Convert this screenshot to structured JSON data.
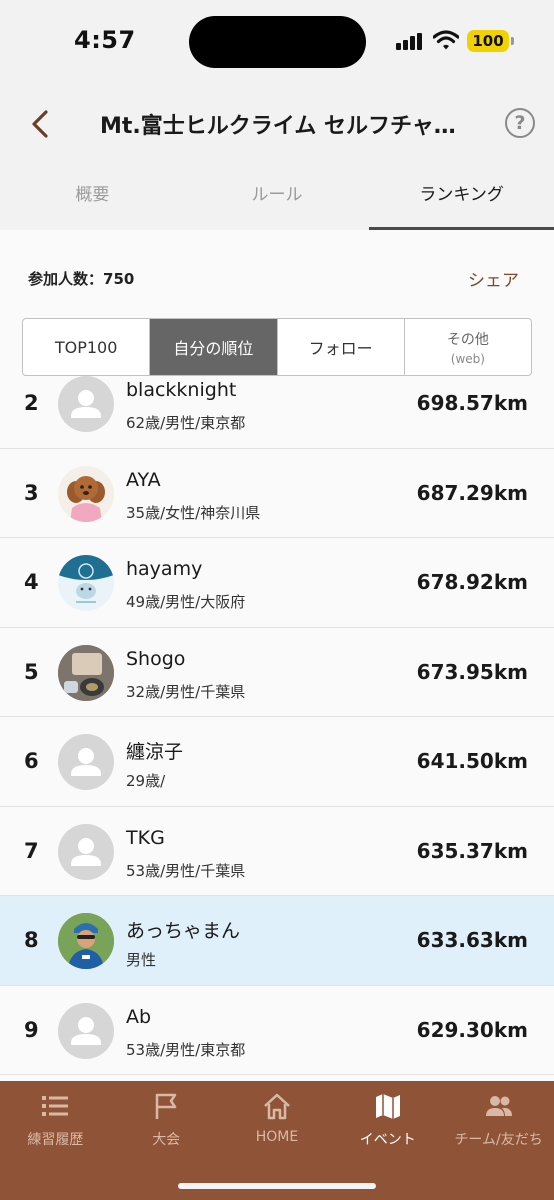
{
  "status": {
    "time": "4:57",
    "battery": "100"
  },
  "header": {
    "title": "Mt.富士ヒルクライム セルフチャ…",
    "help": "?"
  },
  "tabs": [
    {
      "label": "概要"
    },
    {
      "label": "ルール"
    },
    {
      "label": "ランキング"
    }
  ],
  "summary": {
    "participants": "参加人数：750",
    "share": "シェア"
  },
  "filters": {
    "top100": "TOP100",
    "mine": "自分の順位",
    "follow": "フォロー",
    "other": "その他",
    "other_sub": "(web)"
  },
  "ranking": [
    {
      "rank": "2",
      "name": "blackknight",
      "info": "62歳/男性/東京都",
      "distance": "698.57km"
    },
    {
      "rank": "3",
      "name": "AYA",
      "info": "35歳/女性/神奈川県",
      "distance": "687.29km"
    },
    {
      "rank": "4",
      "name": "hayamy",
      "info": "49歳/男性/大阪府",
      "distance": "678.92km"
    },
    {
      "rank": "5",
      "name": "Shogo",
      "info": "32歳/男性/千葉県",
      "distance": "673.95km"
    },
    {
      "rank": "6",
      "name": "纏涼子",
      "info": "29歳/",
      "distance": "641.50km"
    },
    {
      "rank": "7",
      "name": "TKG",
      "info": "53歳/男性/千葉県",
      "distance": "635.37km"
    },
    {
      "rank": "8",
      "name": "あっちゃまん",
      "info": "男性",
      "distance": "633.63km"
    },
    {
      "rank": "9",
      "name": "Ab",
      "info": "53歳/男性/東京都",
      "distance": "629.30km"
    }
  ],
  "nav": [
    {
      "label": "練習履歴",
      "icon": "list-icon"
    },
    {
      "label": "大会",
      "icon": "flag-icon"
    },
    {
      "label": "HOME",
      "icon": "home-icon"
    },
    {
      "label": "イベント",
      "icon": "map-icon"
    },
    {
      "label": "チーム/友だち",
      "icon": "people-icon"
    }
  ],
  "colors": {
    "accent": "#8f5437",
    "highlight": "#dff0fb",
    "segment_active": "#666666"
  }
}
